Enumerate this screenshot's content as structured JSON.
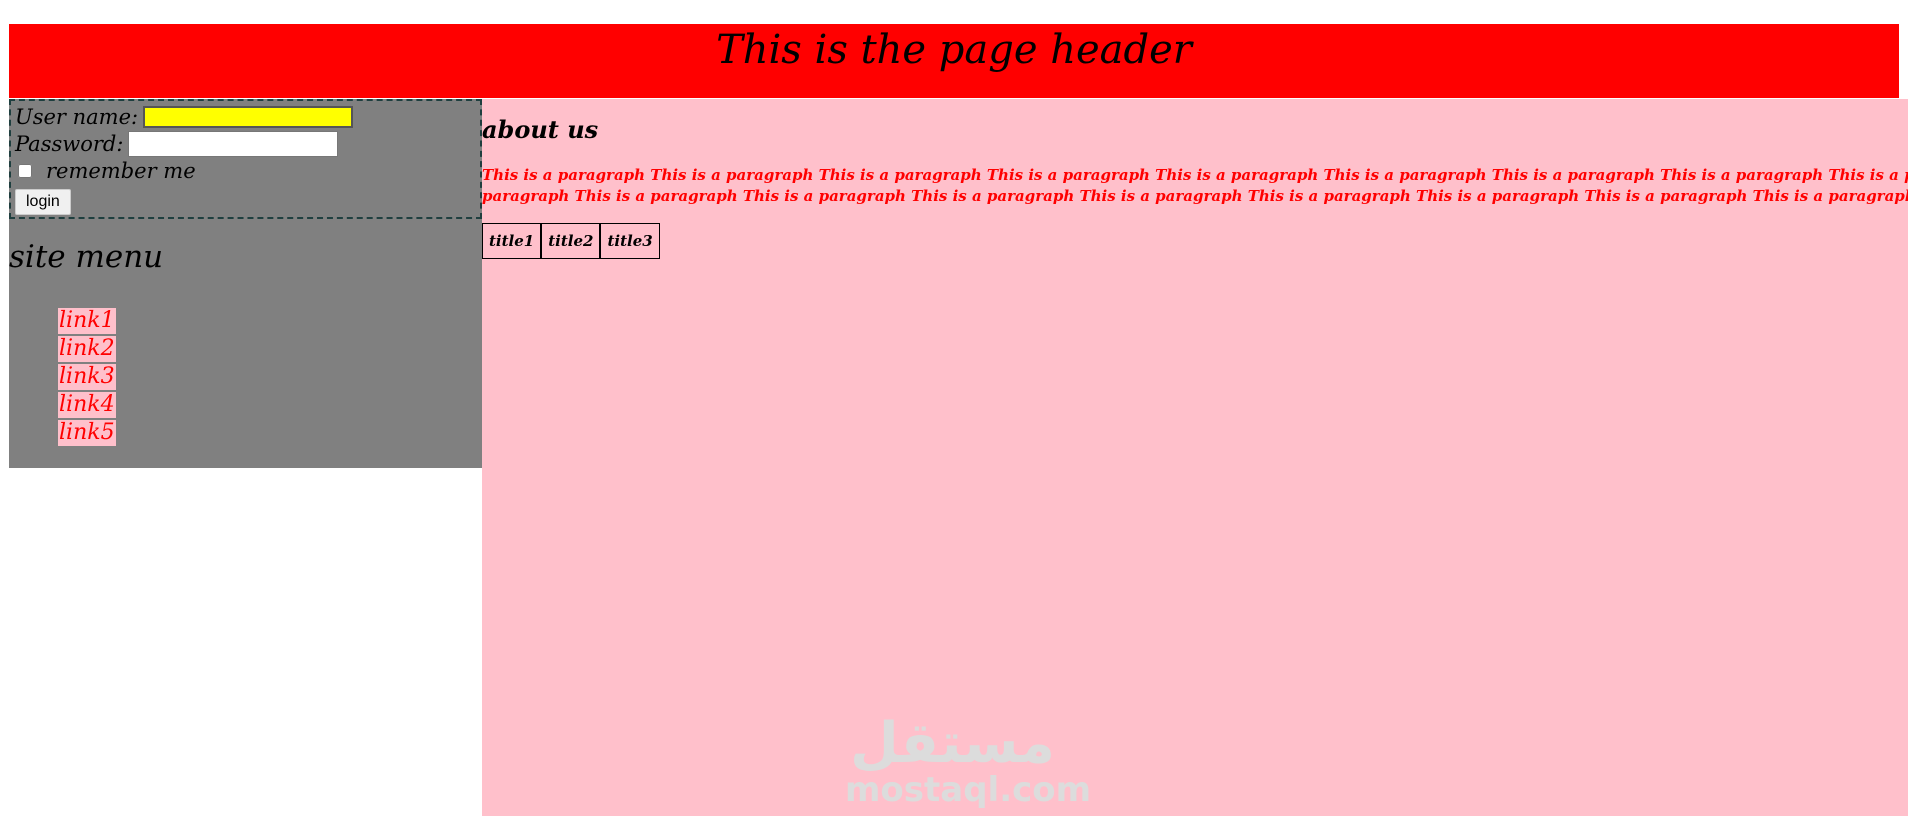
{
  "header": {
    "title": "This is the page header"
  },
  "login": {
    "username_label": "User name:",
    "username_value": "",
    "password_label": "Password:",
    "password_value": "",
    "remember_label": "remember me",
    "remember_checked": false,
    "login_label": "login"
  },
  "sidebar": {
    "menu_title": "site menu",
    "links": [
      {
        "label": "link1"
      },
      {
        "label": "link2"
      },
      {
        "label": "link3"
      },
      {
        "label": "link4"
      },
      {
        "label": "link5"
      }
    ]
  },
  "main": {
    "about_title": "about us",
    "paragraph": "This is a paragraph This is a paragraph This is a paragraph This is a paragraph This is a paragraph This is a paragraph This is a paragraph This is a paragraph This is a paragraph This is a paragraph This is a paragraph This is a paragraph This is a paragraph This is a paragraph This is a paragraph This is a paragraph This is a paragraph This is a paragraph.",
    "table_headers": [
      "title1",
      "title2",
      "title3"
    ]
  },
  "watermark": {
    "arabic": "مستقل",
    "latin": "mostaql.com"
  },
  "colors": {
    "header_bg": "#ff0000",
    "sidebar_bg": "#808080",
    "main_bg": "#ffc0cb",
    "link_color": "#ff0000",
    "username_bg": "#ffff00"
  }
}
